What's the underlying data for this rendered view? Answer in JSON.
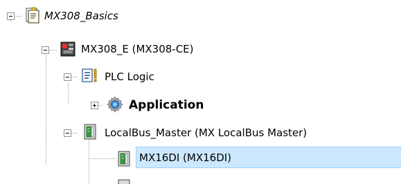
{
  "tree": {
    "project": {
      "label": "MX308_Basics",
      "icon": "project-file-icon"
    },
    "device": {
      "label": "MX308_E (MX308-CE)",
      "icon": "plc-device-icon"
    },
    "plc_logic": {
      "label": "PLC Logic",
      "icon": "plc-logic-icon"
    },
    "application": {
      "label": "Application",
      "icon": "gear-icon"
    },
    "localbus": {
      "label": "LocalBus_Master (MX LocalBus Master)",
      "icon": "io-module-icon"
    },
    "module": {
      "label": "MX16DI (MX16DI)",
      "icon": "io-module-icon",
      "selected": true
    }
  },
  "colors": {
    "selection_bg": "#cce8ff",
    "selection_border": "#99d1ff",
    "connector": "#a0a0a0"
  }
}
